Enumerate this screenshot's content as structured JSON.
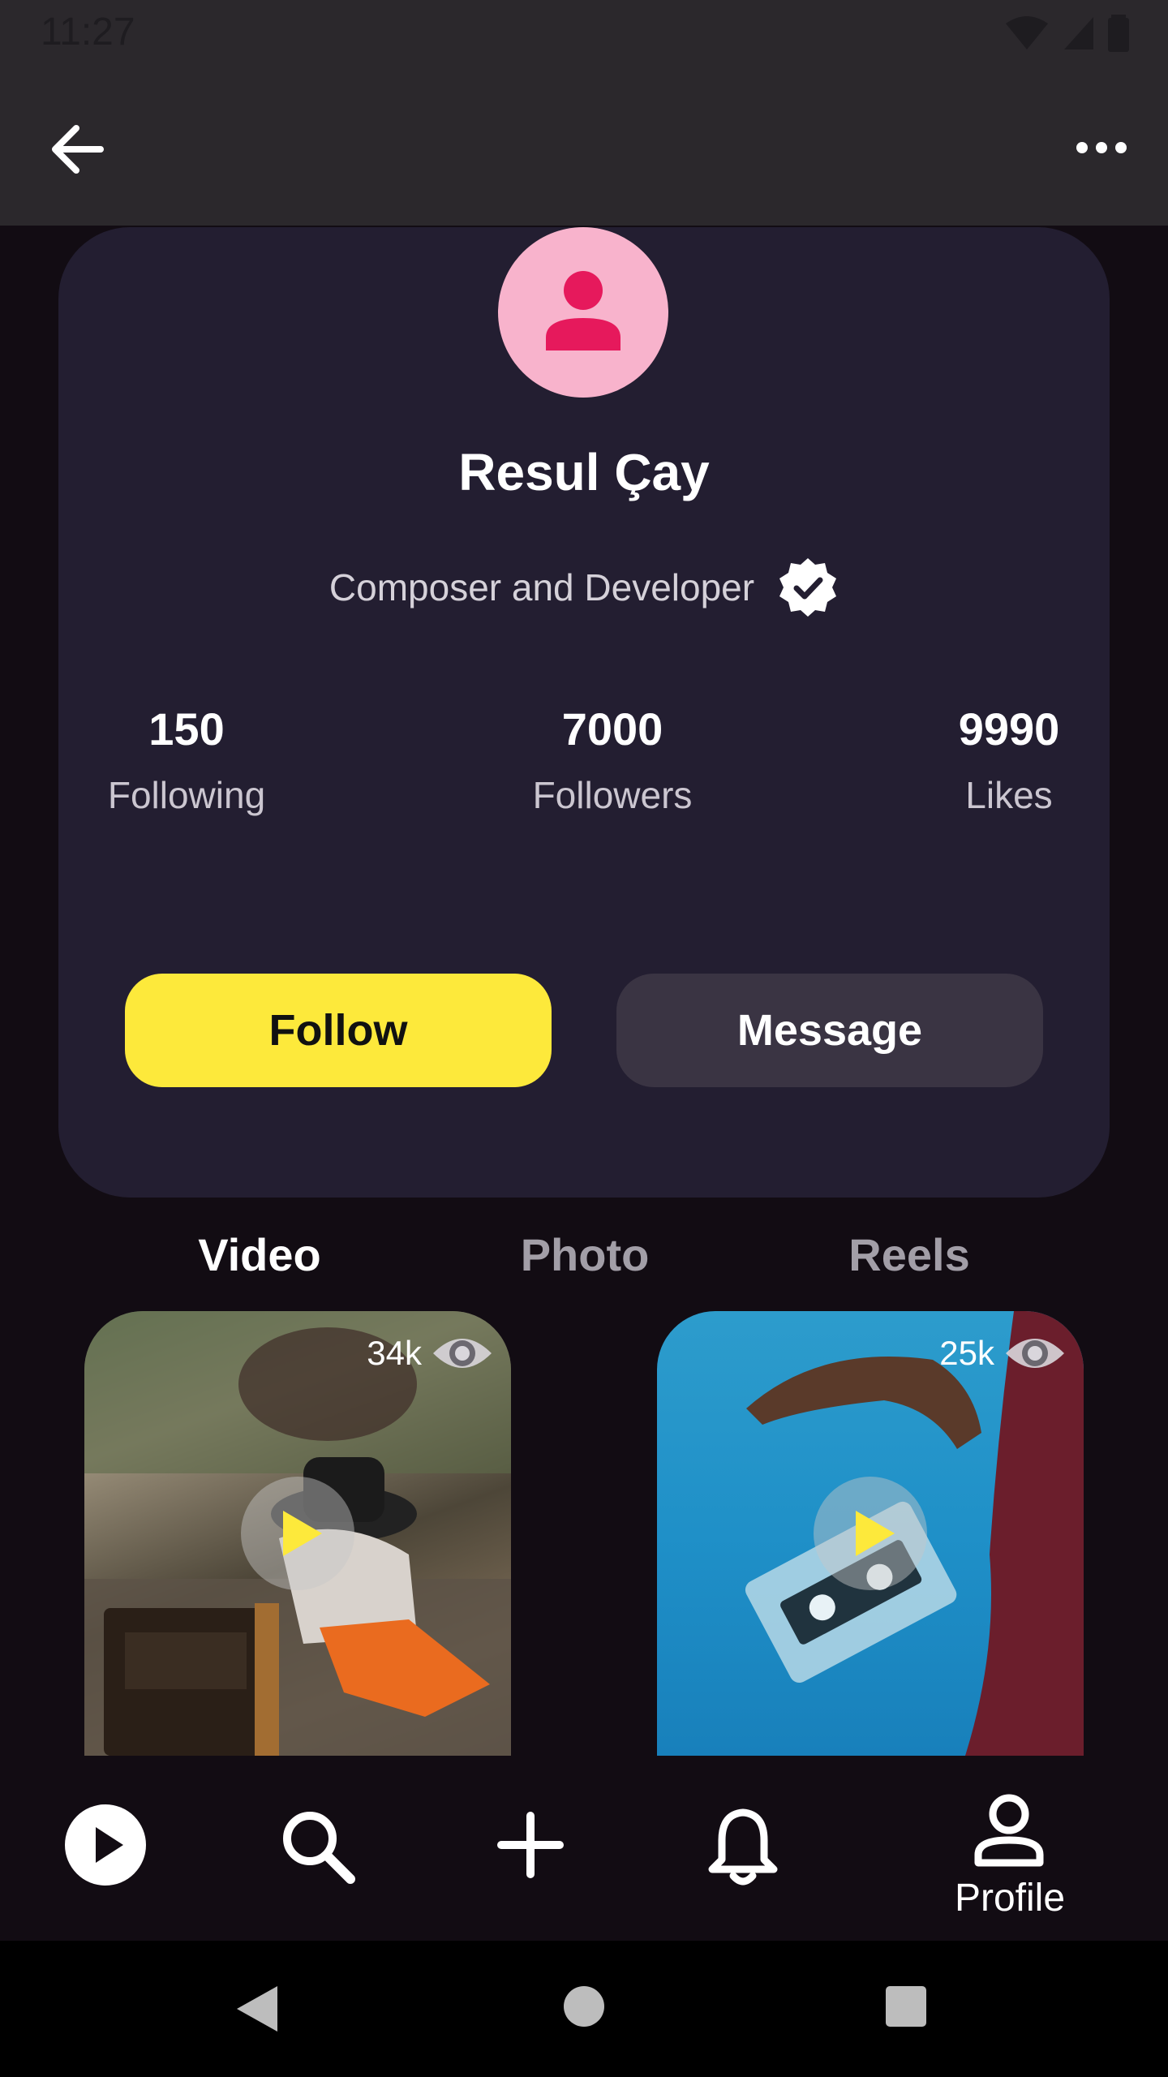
{
  "status_bar": {
    "time": "11:27"
  },
  "profile": {
    "name": "Resul Çay",
    "bio": "Composer and Developer",
    "stats": [
      {
        "value": "150",
        "label": "Following"
      },
      {
        "value": "7000",
        "label": "Followers"
      },
      {
        "value": "9990",
        "label": "Likes"
      }
    ],
    "follow_label": "Follow",
    "message_label": "Message"
  },
  "tabs": [
    {
      "label": "Video",
      "active": true
    },
    {
      "label": "Photo",
      "active": false
    },
    {
      "label": "Reels",
      "active": false
    }
  ],
  "videos": [
    {
      "views": "34k"
    },
    {
      "views": "25k"
    }
  ],
  "bottom_nav": {
    "profile_label": "Profile"
  },
  "colors": {
    "accent_yellow": "#fde93b",
    "avatar_bg": "#f8b3cc",
    "avatar_icon": "#e6195c",
    "card_bg": "#231e31"
  },
  "icons": {
    "back": "arrow-left-icon",
    "more": "more-horizontal-icon",
    "verified": "verified-badge-icon",
    "eye": "eye-icon",
    "play": "play-icon",
    "search": "search-icon",
    "add": "plus-icon",
    "notifications": "bell-icon",
    "profile": "person-icon"
  }
}
